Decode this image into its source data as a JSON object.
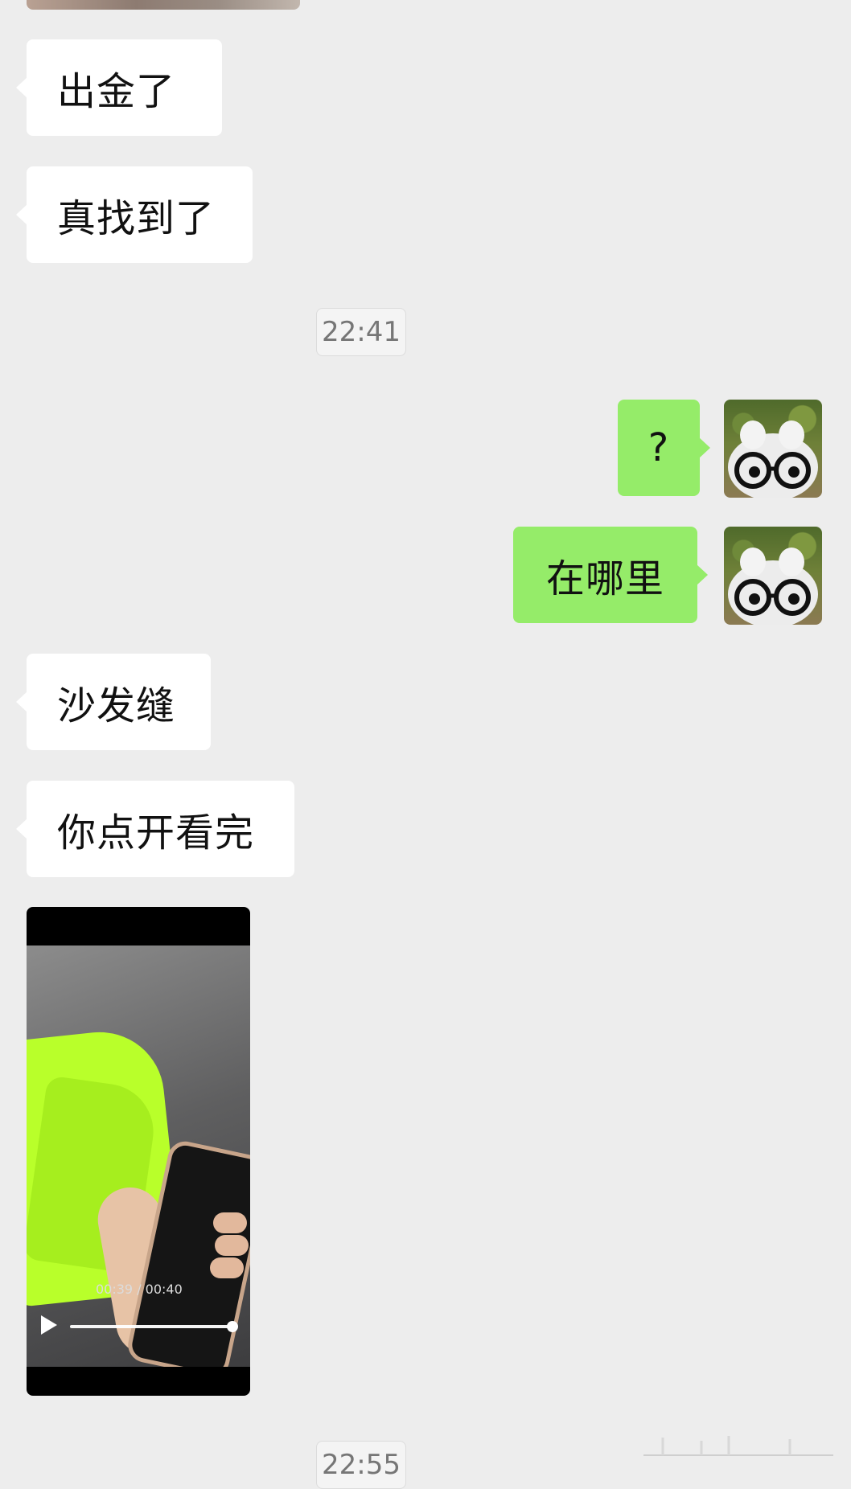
{
  "messages": [
    {
      "text": "出金了"
    },
    {
      "text": "真找到了"
    },
    {
      "text": "?"
    },
    {
      "text": "在哪里"
    },
    {
      "text": "沙发缝"
    },
    {
      "text": "你点开看完"
    }
  ],
  "timestamps": [
    "22:41",
    "22:55"
  ],
  "video": {
    "time": "00:39 / 00:40",
    "progress": 0.975
  },
  "colors": {
    "background": "#ededed",
    "incoming_bubble": "#ffffff",
    "outgoing_bubble": "#95ec69"
  },
  "icons": {
    "avatar": "plush-toy-with-glasses-avatar",
    "play": "play-icon"
  }
}
